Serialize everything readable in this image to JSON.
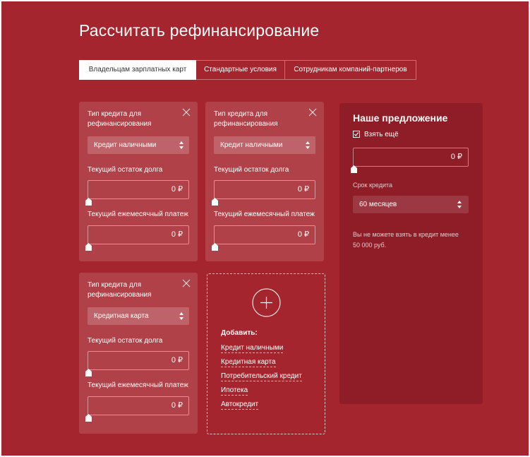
{
  "page": {
    "title": "Рассчитать рефинансирование",
    "colors": {
      "background": "#a5252e",
      "offer_panel": "#8f1d27"
    }
  },
  "tabs": [
    {
      "label": "Владельцам зарплатных карт",
      "active": true
    },
    {
      "label": "Стандартные условия",
      "active": false
    },
    {
      "label": "Сотрудникам компаний-партнеров",
      "active": false
    }
  ],
  "credit_cards": [
    {
      "title": "Тип кредита для рефинансирования",
      "type_value": "Кредит наличными",
      "balance_label": "Текущий остаток долга",
      "balance_value": "0 ₽",
      "payment_label": "Текущий ежемесячный платеж",
      "payment_value": "0 ₽"
    },
    {
      "title": "Тип кредита для рефинансирования",
      "type_value": "Кредит наличными",
      "balance_label": "Текущий остаток долга",
      "balance_value": "0 ₽",
      "payment_label": "Текущий ежемесячный платеж",
      "payment_value": "0 ₽"
    },
    {
      "title": "Тип кредита для рефинансирования",
      "type_value": "Кредитная карта",
      "balance_label": "Текущий остаток долга",
      "balance_value": "0 ₽",
      "payment_label": "Текущий ежемесячный платеж",
      "payment_value": "0 ₽"
    }
  ],
  "add_panel": {
    "label": "Добавить:",
    "links": [
      "Кредит наличными",
      "Кредитная карта",
      "Потребительский кредит",
      "Ипотека",
      "Автокредит"
    ]
  },
  "offer": {
    "title": "Наше предложение",
    "checkbox_label": "Взять ещё",
    "checkbox_checked": true,
    "amount_value": "0 ₽",
    "term_label": "Срок кредита",
    "term_value": "60 месяцев",
    "note": "Вы не можете взять в кредит менее 50 000 руб."
  }
}
